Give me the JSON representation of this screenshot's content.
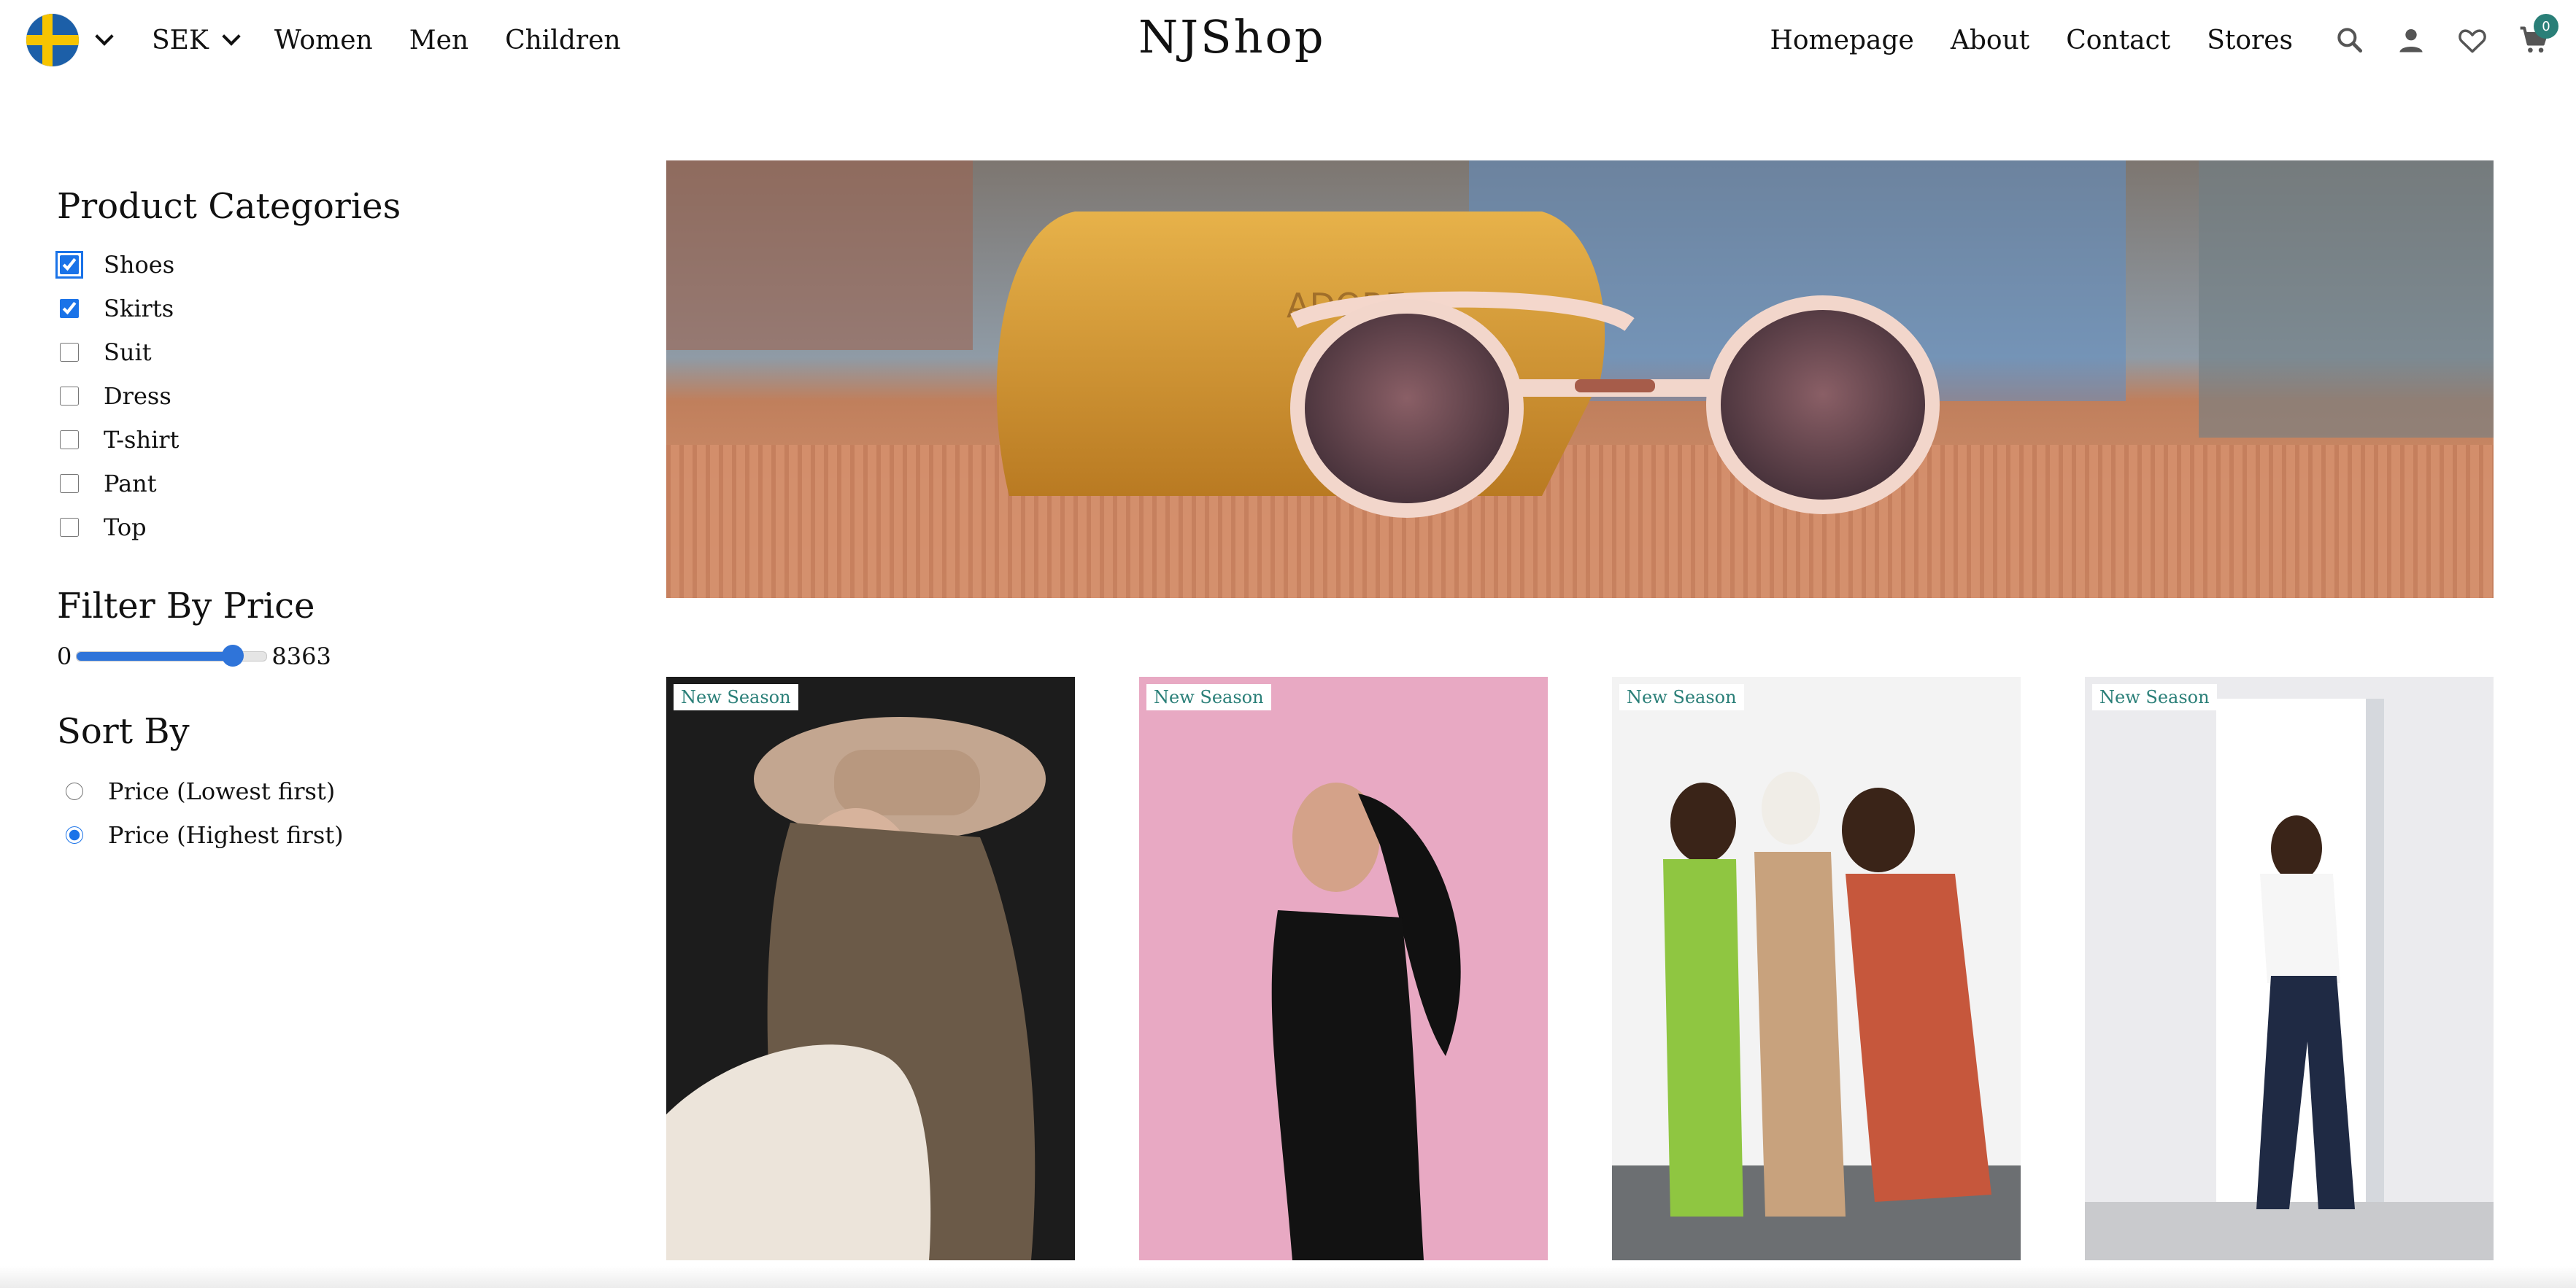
{
  "nav": {
    "flag": {
      "name": "sweden-flag",
      "colors": {
        "blue": "#1c5fa8",
        "yellow": "#f7c400"
      }
    },
    "currency": "SEK",
    "left_links": [
      "Women",
      "Men",
      "Children"
    ],
    "brand": "NJShop",
    "right_links": [
      "Homepage",
      "About",
      "Contact",
      "Stores"
    ],
    "icons": [
      "search-icon",
      "user-icon",
      "heart-icon",
      "cart-icon"
    ],
    "cart_count": "0",
    "accent_color": "#2a7f78"
  },
  "sidebar": {
    "categories_title": "Product Categories",
    "categories": [
      {
        "label": "Shoes",
        "checked": true
      },
      {
        "label": "Skirts",
        "checked": true
      },
      {
        "label": "Suit",
        "checked": false
      },
      {
        "label": "Dress",
        "checked": false
      },
      {
        "label": "T-shirt",
        "checked": false
      },
      {
        "label": "Pant",
        "checked": false
      },
      {
        "label": "Top",
        "checked": false
      }
    ],
    "price_title": "Filter By Price",
    "price_min": "0",
    "price_max": "8363",
    "price_level": 0.82,
    "sort_title": "Sort By",
    "sort_options": [
      {
        "label": "Price (Lowest first)",
        "checked": false
      },
      {
        "label": "Price (Highest first)",
        "checked": true
      }
    ]
  },
  "banner": {
    "image": "sunglasses-banner"
  },
  "products": [
    {
      "tag": "New Season",
      "image": "woman-in-hat"
    },
    {
      "tag": "New Season",
      "image": "woman-pink-background"
    },
    {
      "tag": "New Season",
      "image": "three-women-coats"
    },
    {
      "tag": "New Season",
      "image": "woman-white-shirt"
    }
  ]
}
